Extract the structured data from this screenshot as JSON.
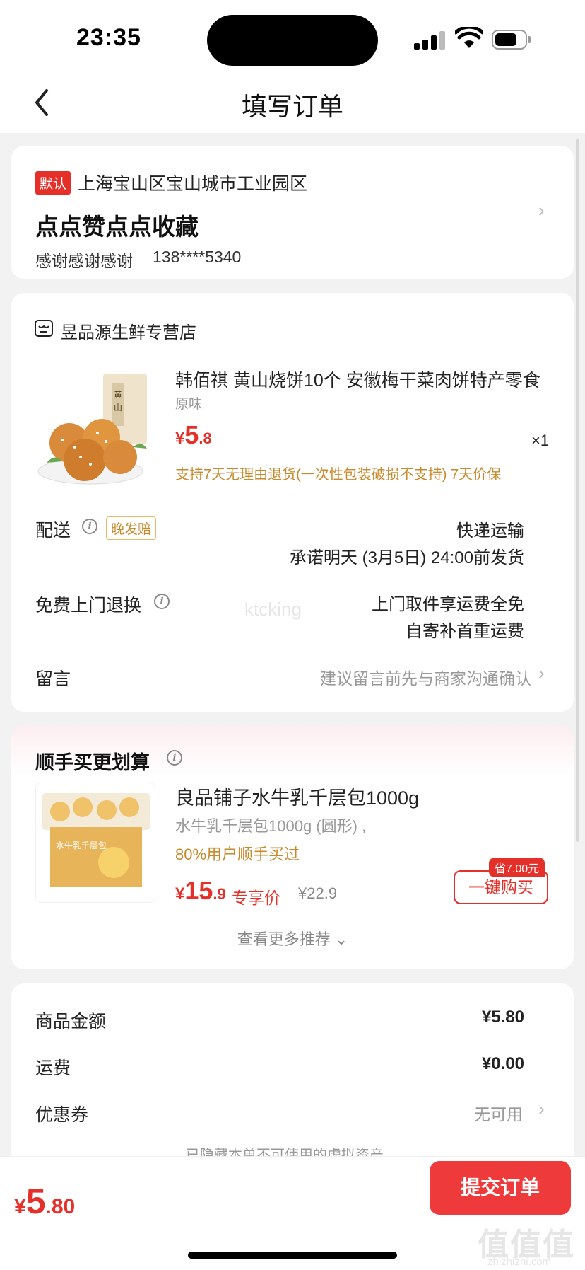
{
  "status": {
    "time": "23:35"
  },
  "nav": {
    "title": "填写订单"
  },
  "address": {
    "default_tag": "默认",
    "region": "上海宝山区宝山城市工业园区",
    "detail": "点点赞点点收藏",
    "contact_name": "感谢感谢感谢",
    "phone": "138****5340"
  },
  "shop": {
    "name": "昱品源生鲜专营店",
    "product": {
      "title": "韩佰祺 黄山烧饼10个 安徽梅干菜肉饼特产零食",
      "spec": "原味",
      "price_symbol": "¥",
      "price_int": "5",
      "price_dec": ".8",
      "qty": "×1",
      "promise": "支持7天无理由退货(一次性包装破损不支持)  7天价保"
    },
    "delivery": {
      "label": "配送",
      "late_tag": "晚发赔",
      "method": "快递运输",
      "promise": "承诺明天 (3月5日) 24:00前发货"
    },
    "return": {
      "label": "免费上门退换",
      "line1": "上门取件享运费全免",
      "line2": "自寄补首重运费"
    },
    "remark": {
      "label": "留言",
      "placeholder": "建议留言前先与商家沟通确认"
    },
    "watermark": "ktcking"
  },
  "recommend": {
    "title": "顺手买更划算",
    "item": {
      "name": "良品铺子水牛乳千层包1000g",
      "spec": "水牛乳千层包1000g (圆形)  ,",
      "users": "80%用户顺手买过",
      "price_symbol": "¥",
      "price_int": "15",
      "price_dec": ".9",
      "price_tag": "专享价",
      "original_price": "¥22.9",
      "save_badge": "省7.00元",
      "buy_button": "一键购买"
    },
    "more": "查看更多推荐"
  },
  "summary": {
    "goods_label": "商品金额",
    "goods_value": "¥5.80",
    "shipping_label": "运费",
    "shipping_value": "¥0.00",
    "coupon_label": "优惠券",
    "coupon_value": "无可用",
    "hidden_assets": "已隐藏本单不可使用的虚拟资产"
  },
  "bottom": {
    "total_symbol": "¥",
    "total_int": "5",
    "total_dec": ".80",
    "submit": "提交订单",
    "watermark": "值值值",
    "watermark_sub": "zhizhizhi.com"
  },
  "colors": {
    "accent": "#e5302a",
    "promise": "#c98a2c",
    "submit": "#ee3a3a"
  }
}
